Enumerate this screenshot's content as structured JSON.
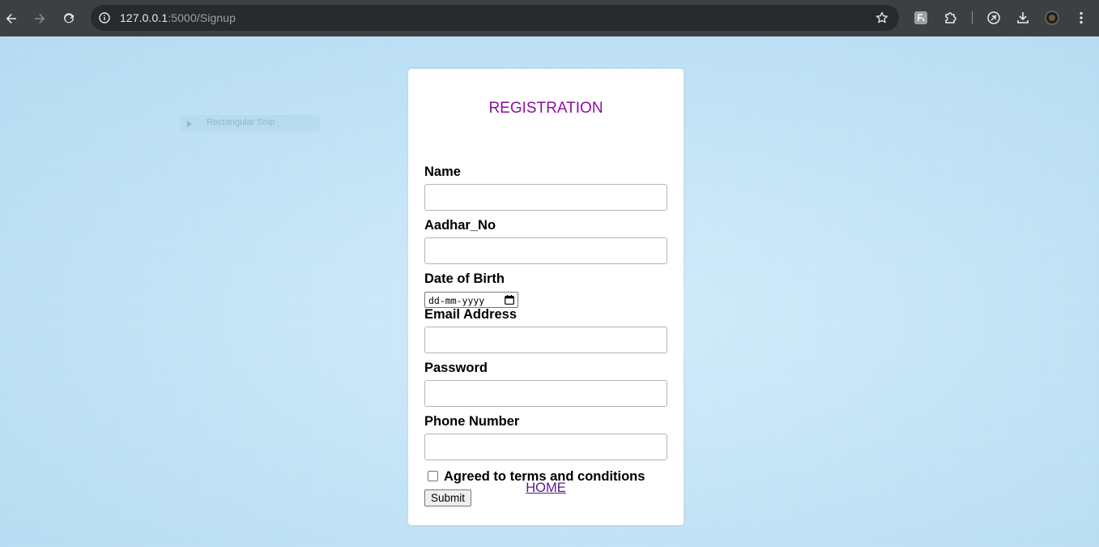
{
  "browser": {
    "url_host": "127.0.0.1",
    "url_path": ":5000/Signup"
  },
  "background": {
    "ghost_label": "Rectangular Snip"
  },
  "form": {
    "title": "REGISTRATION",
    "fields": {
      "name_label": "Name",
      "aadhar_label": "Aadhar_No",
      "dob_label": "Date of Birth",
      "dob_placeholder": "dd-mm-yyyy",
      "email_label": "Email Address",
      "password_label": "Password",
      "phone_label": "Phone Number"
    },
    "terms_label": "Agreed to terms and conditions",
    "submit_label": "Submit",
    "home_link": "HOME"
  },
  "colors": {
    "title": "#8b119b",
    "link": "#551a8b",
    "page_background": "#c3e3f6"
  }
}
